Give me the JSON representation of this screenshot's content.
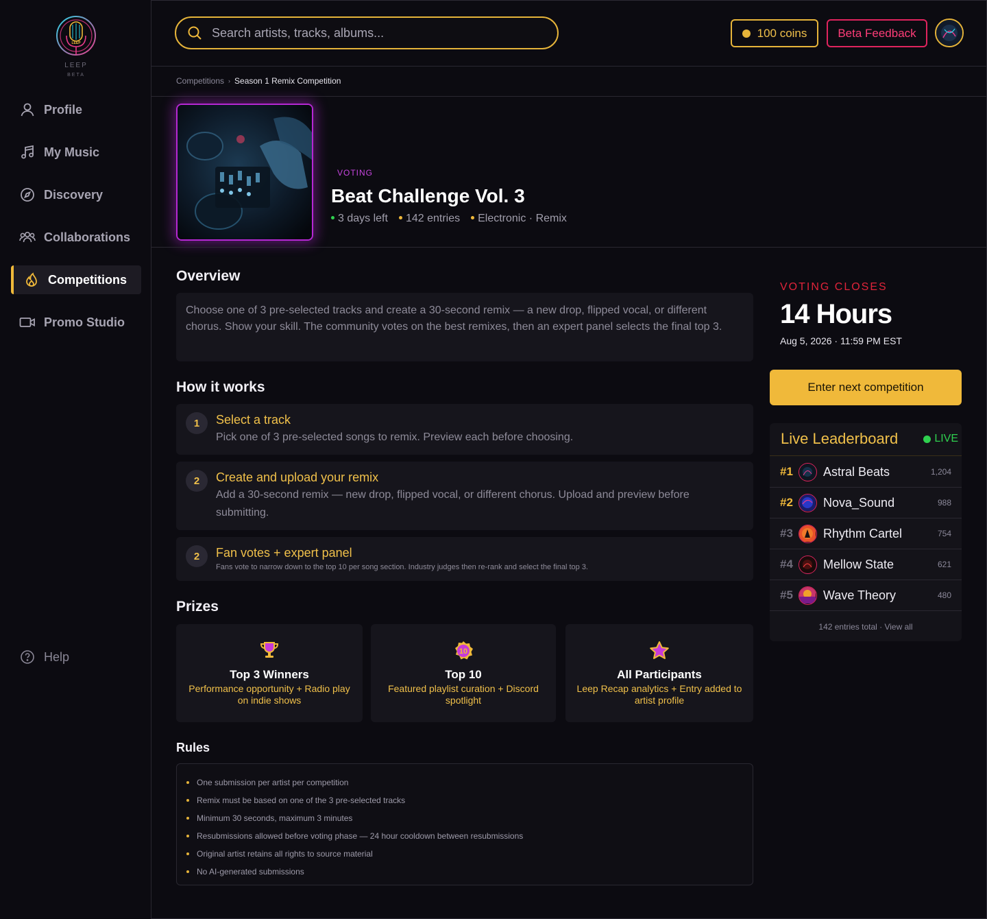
{
  "logo": {
    "brand": "LEEP",
    "tag": "BETA"
  },
  "nav": [
    {
      "label": "Profile",
      "icon": "user-icon"
    },
    {
      "label": "My Music",
      "icon": "music-note-icon"
    },
    {
      "label": "Discovery",
      "icon": "compass-icon"
    },
    {
      "label": "Collaborations",
      "icon": "users-icon"
    },
    {
      "label": "Competitions",
      "icon": "flame-icon",
      "active": true
    },
    {
      "label": "Promo Studio",
      "icon": "video-camera-icon"
    }
  ],
  "help": {
    "label": "Help",
    "icon": "question-icon"
  },
  "search": {
    "placeholder": "Search artists, tracks, albums..."
  },
  "coins": {
    "label": "100 coins"
  },
  "beta_feedback": {
    "label": "Beta Feedback"
  },
  "breadcrumb": {
    "parent": "Competitions",
    "current": "Season 1 Remix Competition"
  },
  "competition": {
    "status": "VOTING",
    "title": "Beat Challenge Vol. 3",
    "time_left": "3 days left",
    "entries": "142 entries",
    "genre": "Electronic · Remix"
  },
  "overview": {
    "heading": "Overview",
    "text": "Choose one of 3 pre-selected tracks and create a 30-second remix — a new drop, flipped vocal, or different chorus. Show your skill. The community votes on the best remixes, then an expert panel selects the final top 3."
  },
  "how": {
    "heading": "How it works",
    "steps": [
      {
        "num": "1",
        "title": "Select a track",
        "desc": "Pick one of 3 pre-selected songs to remix. Preview each before choosing."
      },
      {
        "num": "2",
        "title": "Create and upload your remix",
        "desc": "Add a 30-second remix — new drop, flipped vocal, or different chorus. Upload and preview before submitting."
      },
      {
        "num": "2",
        "title": "Fan votes + expert panel",
        "desc": "Fans vote to narrow down to the top 10 per song section. Industry judges then re-rank and select the final top 3."
      }
    ]
  },
  "prizes": {
    "heading": "Prizes",
    "items": [
      {
        "title": "Top 3 Winners",
        "desc": "Performance opportunity + Radio play on indie shows",
        "icon": "trophy-icon"
      },
      {
        "title": "Top 10",
        "desc": "Featured playlist curation + Discord spotlight",
        "icon": "badge-10-icon",
        "badge": "10"
      },
      {
        "title": "All Participants",
        "desc": "Leep Recap analytics + Entry added to artist profile",
        "icon": "star-icon"
      }
    ]
  },
  "rules": {
    "heading": "Rules",
    "items": [
      "One submission per artist per competition",
      "Remix must be based on one of the 3 pre-selected tracks",
      "Minimum 30 seconds, maximum 3 minutes",
      "Resubmissions allowed before voting phase — 24 hour cooldown between resubmissions",
      "Original artist retains all rights to source material",
      "No AI-generated submissions"
    ]
  },
  "voting": {
    "label": "VOTING CLOSES",
    "hours": "14 Hours",
    "date": "Aug 5, 2026 · 11:59 PM EST"
  },
  "enter_button": {
    "label": "Enter next competition"
  },
  "leaderboard": {
    "title": "Live Leaderboard",
    "live": "LIVE",
    "rows": [
      {
        "rank": "#1",
        "name": "Astral Beats",
        "score": "1,204",
        "rank_color": "#f0b93a"
      },
      {
        "rank": "#2",
        "name": "Nova_Sound",
        "score": "988",
        "rank_color": "#f0b93a"
      },
      {
        "rank": "#3",
        "name": "Rhythm Cartel",
        "score": "754",
        "rank_color": "#6f6c7a"
      },
      {
        "rank": "#4",
        "name": "Mellow State",
        "score": "621",
        "rank_color": "#6f6c7a"
      },
      {
        "rank": "#5",
        "name": "Wave Theory",
        "score": "480",
        "rank_color": "#6f6c7a"
      }
    ],
    "footer": "142 entries total · View all"
  },
  "colors": {
    "accent": "#f0b93a",
    "danger": "#e0245e",
    "live": "#2fd04f",
    "status": "#c745e0"
  }
}
